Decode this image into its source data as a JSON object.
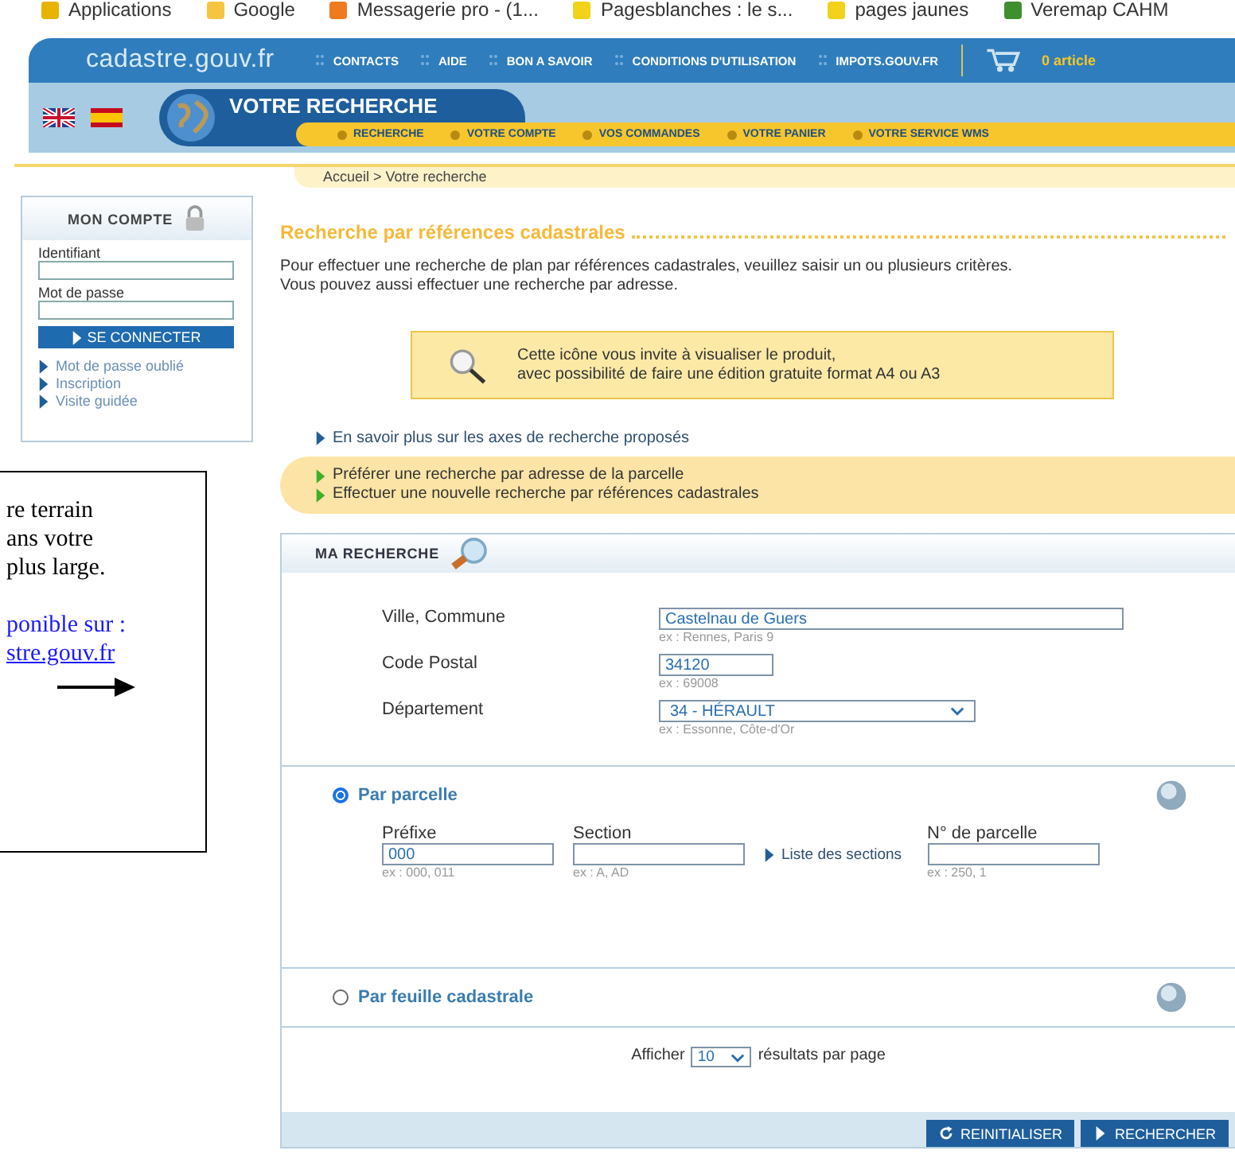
{
  "bookmarks": [
    {
      "label": "Applications"
    },
    {
      "label": "Google"
    },
    {
      "label": "Messagerie pro - (1..."
    },
    {
      "label": "Pagesblanches : le s..."
    },
    {
      "label": "pages jaunes"
    },
    {
      "label": "Veremap CAHM"
    }
  ],
  "site": {
    "logo": "cadastre.gouv.fr",
    "top_links": [
      "CONTACTS",
      "AIDE",
      "BON A SAVOIR",
      "CONDITIONS D'UTILISATION",
      "IMPOTS.GOUV.FR"
    ],
    "cart": "0 article"
  },
  "section_title": "VOTRE RECHERCHE",
  "main_nav": [
    "RECHERCHE",
    "VOTRE COMPTE",
    "VOS COMMANDES",
    "VOTRE PANIER",
    "VOTRE SERVICE WMS"
  ],
  "breadcrumb": "Accueil > Votre recherche",
  "account": {
    "title": "MON COMPTE",
    "fields": [
      {
        "label": "Identifiant"
      },
      {
        "label": "Mot de passe"
      }
    ],
    "login_button": "SE CONNECTER",
    "links": [
      "Mot de passe oublié",
      "Inscription",
      "Visite guidée"
    ]
  },
  "page_title": "Recherche par références cadastrales",
  "intro": [
    "Pour effectuer une recherche de plan par références cadastrales, veuillez saisir un ou plusieurs critères.",
    "Vous pouvez aussi effectuer une recherche par adresse."
  ],
  "info_box": [
    "Cette icône vous invite à visualiser le produit,",
    "avec possibilité de faire une édition gratuite format A4 ou A3"
  ],
  "more_link": "En savoir plus sur les axes de recherche proposés",
  "alt_links": [
    "Préférer une recherche par adresse de la parcelle",
    "Effectuer une nouvelle recherche par références cadastrales"
  ],
  "search": {
    "title": "MA RECHERCHE",
    "fields": [
      {
        "label": "Ville, Commune",
        "value": "Castelnau de Guers",
        "hint": "ex : Rennes, Paris 9",
        "kind": "text"
      },
      {
        "label": "Code Postal",
        "value": "34120",
        "hint": "ex : 69008",
        "kind": "text"
      },
      {
        "label": "Département",
        "value": "34 - HÉRAULT",
        "hint": "ex : Essonne, Côte-d'Or",
        "kind": "select"
      }
    ],
    "modes": [
      {
        "label": "Par parcelle",
        "selected": true,
        "fields": [
          {
            "label": "Préfixe",
            "value": "000",
            "hint": "ex : 000, 011"
          },
          {
            "label": "Section",
            "hint": "ex : A, AD",
            "link": "Liste des sections"
          },
          {
            "label": "N° de parcelle",
            "hint": "ex : 250, 1"
          }
        ]
      },
      {
        "label": "Par feuille cadastrale",
        "selected": false
      }
    ],
    "per_page": {
      "before": "Afficher",
      "value": "10",
      "after": "résultats par page"
    },
    "buttons": [
      {
        "label": "REINITIALISER",
        "kind": "reset"
      },
      {
        "label": "RECHERCHER",
        "kind": "submit"
      }
    ]
  },
  "note": {
    "lines": [
      "re terrain",
      "ans votre",
      "plus large."
    ],
    "available": "ponible sur :",
    "link": "stre.gouv.fr"
  }
}
